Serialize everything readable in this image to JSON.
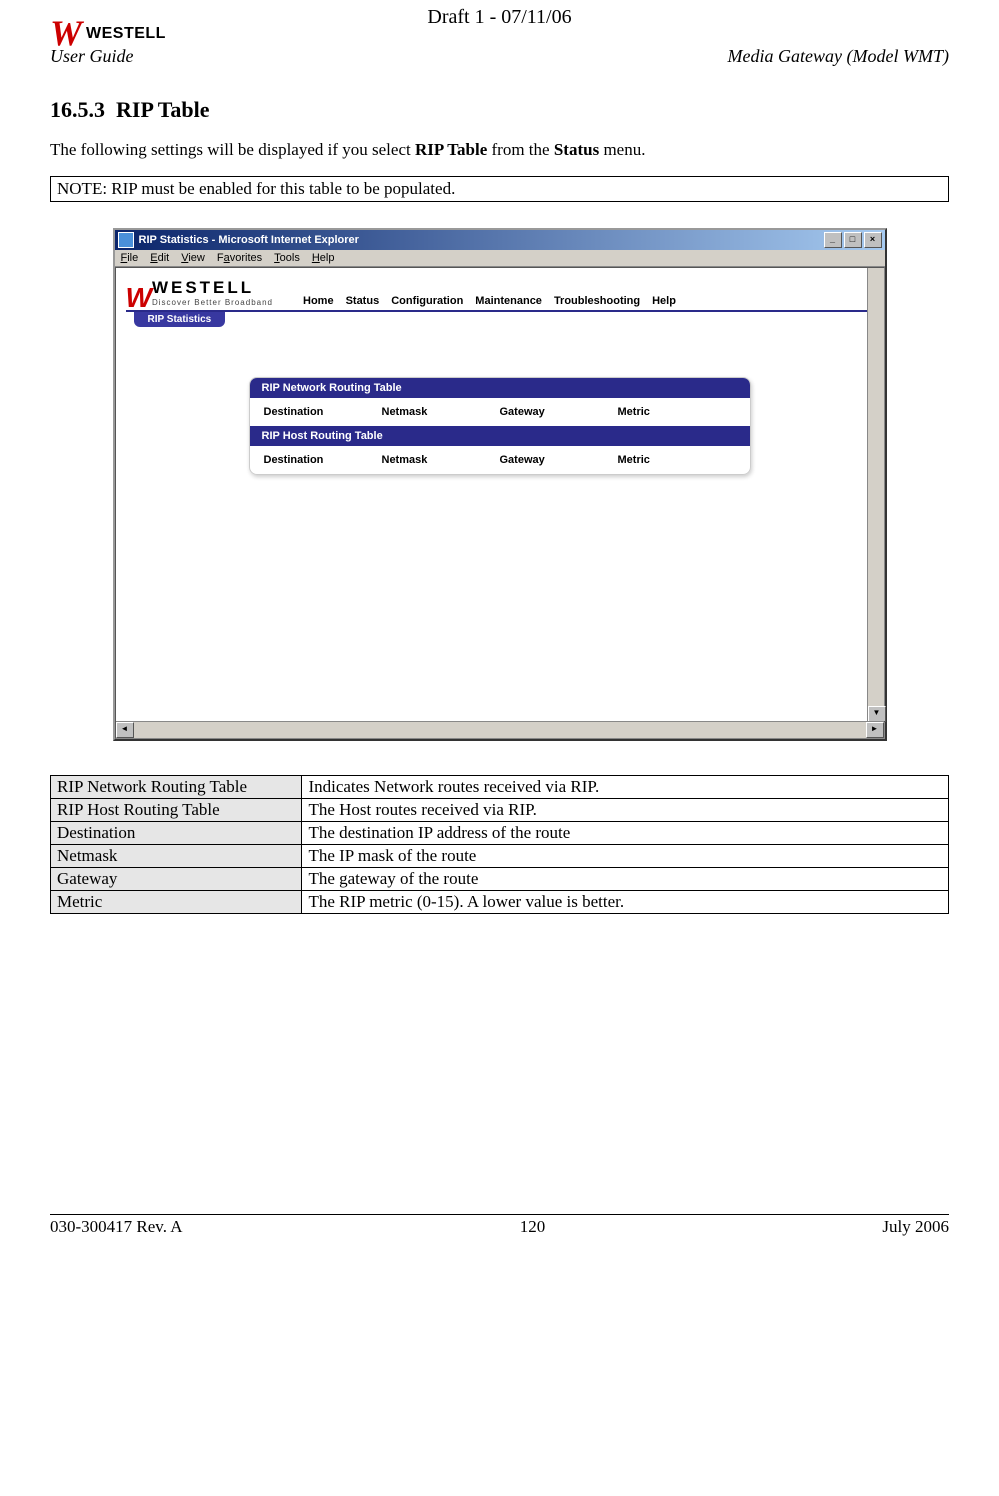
{
  "draft_header": "Draft 1 - 07/11/06",
  "logo_brand": "WESTELL",
  "user_guide": "User Guide",
  "model_label": "Media Gateway (Model WMT)",
  "section_number": "16.5.3",
  "section_title": "RIP Table",
  "intro_prefix": "The following settings will be displayed if you select ",
  "intro_bold1": "RIP Table",
  "intro_mid": " from the ",
  "intro_bold2": "Status",
  "intro_suffix": " menu.",
  "note_text": "NOTE: RIP must be enabled for this table to be populated.",
  "ie": {
    "title": "RIP Statistics - Microsoft Internet Explorer",
    "menus": [
      "File",
      "Edit",
      "View",
      "Favorites",
      "Tools",
      "Help"
    ],
    "page_logo_text": "WESTELL",
    "page_logo_sub": "Discover Better Broadband",
    "nav": [
      "Home",
      "Status",
      "Configuration",
      "Maintenance",
      "Troubleshooting",
      "Help"
    ],
    "tab": "RIP Statistics",
    "panel1_header": "RIP Network Routing Table",
    "panel2_header": "RIP Host Routing Table",
    "cols": [
      "Destination",
      "Netmask",
      "Gateway",
      "Metric"
    ]
  },
  "definitions": [
    {
      "term": "RIP Network Routing Table",
      "desc": "Indicates Network routes received via RIP."
    },
    {
      "term": "RIP Host Routing Table",
      "desc": "The Host routes received via RIP."
    },
    {
      "term": "Destination",
      "desc": "The destination IP address of the route"
    },
    {
      "term": "Netmask",
      "desc": "The IP mask of the route"
    },
    {
      "term": "Gateway",
      "desc": "The gateway of the route"
    },
    {
      "term": "Metric",
      "desc": "The RIP metric  (0-15). A lower value is better."
    }
  ],
  "footer": {
    "left": "030-300417 Rev. A",
    "center": "120",
    "right": "July 2006"
  }
}
